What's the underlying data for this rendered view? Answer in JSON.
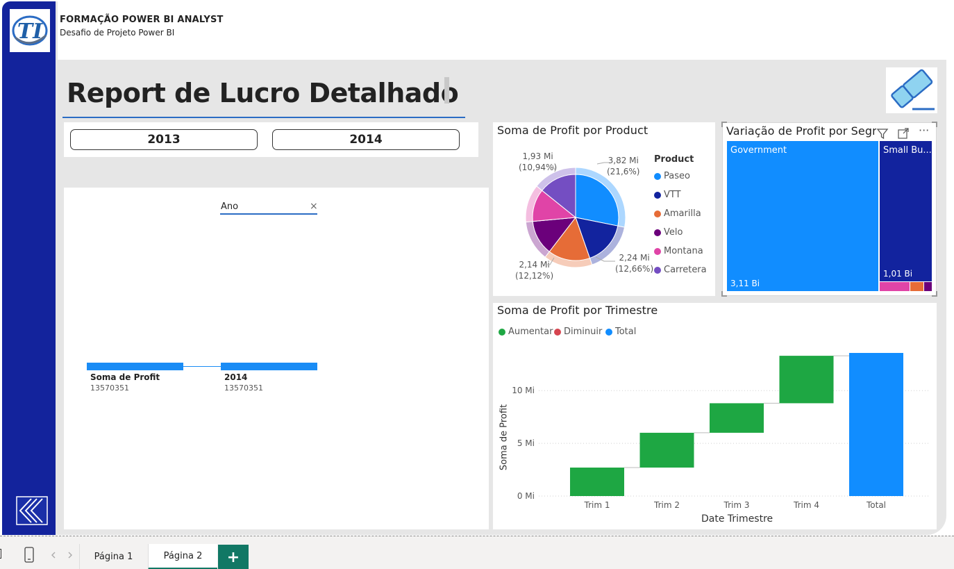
{
  "header": {
    "title": "FORMAÇÃO POWER BI ANALYST",
    "subtitle": "Desafio de Projeto Power BI",
    "logo_text": "TI"
  },
  "report": {
    "title": "Report de Lucro Detalhado"
  },
  "slicer": {
    "options": [
      "2013",
      "2014"
    ]
  },
  "decomposition_tree": {
    "level_label": "Ano",
    "close_symbol": "×",
    "nodes": [
      {
        "label": "Soma de Profit",
        "value": "13570351"
      },
      {
        "label": "2014",
        "value": "13570351"
      }
    ]
  },
  "pie": {
    "title": "Soma de Profit por Product",
    "legend_title": "Product",
    "labels": [
      {
        "value": "3,82 Mi",
        "pct": "(21,6%)"
      },
      {
        "value": "2,24 Mi",
        "pct": "(12,66%)"
      },
      {
        "value": "2,14 Mi",
        "pct": "(12,12%)"
      },
      {
        "value": "1,93 Mi",
        "pct": "(10,94%)"
      }
    ]
  },
  "treemap": {
    "title": "Variação de Profit por Segment",
    "cells": [
      {
        "name": "Government",
        "value": "3,11 Bi"
      },
      {
        "name": "Small Bu...",
        "value": "1,01 Bi"
      }
    ],
    "more_symbol": "···"
  },
  "waterfall": {
    "title": "Soma de Profit por Trimestre",
    "legend": [
      {
        "label": "Aumentar",
        "color": "#1ea743"
      },
      {
        "label": "Diminuir",
        "color": "#d64550"
      },
      {
        "label": "Total",
        "color": "#118dff"
      }
    ],
    "y_ticks": [
      "10 Mi",
      "5 Mi",
      "0 Mi"
    ],
    "ylabel": "Soma de Profit",
    "xlabel": "Date Trimestre"
  },
  "chart_data": [
    {
      "type": "pie",
      "title": "Soma de Profit por Product",
      "legend_title": "Product",
      "categories": [
        "Paseo",
        "VTT",
        "Amarilla",
        "Velo",
        "Montana",
        "Carretera"
      ],
      "values": [
        3.82,
        2.24,
        2.14,
        1.78,
        1.66,
        1.93
      ],
      "unit": "Mi",
      "colors": [
        "#118dff",
        "#12239e",
        "#e66c37",
        "#6b007b",
        "#e044a7",
        "#744ec2"
      ]
    },
    {
      "type": "treemap",
      "title": "Variação de Profit por Segment",
      "categories": [
        "Government",
        "Small Bu..."
      ],
      "values": [
        3.11,
        1.01
      ],
      "unit": "Bi"
    },
    {
      "type": "waterfall",
      "title": "Soma de Profit por Trimestre",
      "categories": [
        "Trim 1",
        "Trim 2",
        "Trim 3",
        "Trim 4",
        "Total"
      ],
      "values": [
        2.7,
        3.3,
        2.8,
        4.5,
        13.57
      ],
      "unit": "Mi",
      "xlabel": "Date Trimestre",
      "ylabel": "Soma de Profit",
      "ylim": [
        0,
        13.57
      ],
      "y_ticks": [
        0,
        5,
        10
      ],
      "legend_placement": "top-left",
      "grid": true
    }
  ],
  "tabs": {
    "pages": [
      "Página 1",
      "Página 2"
    ],
    "add_label": "+"
  }
}
